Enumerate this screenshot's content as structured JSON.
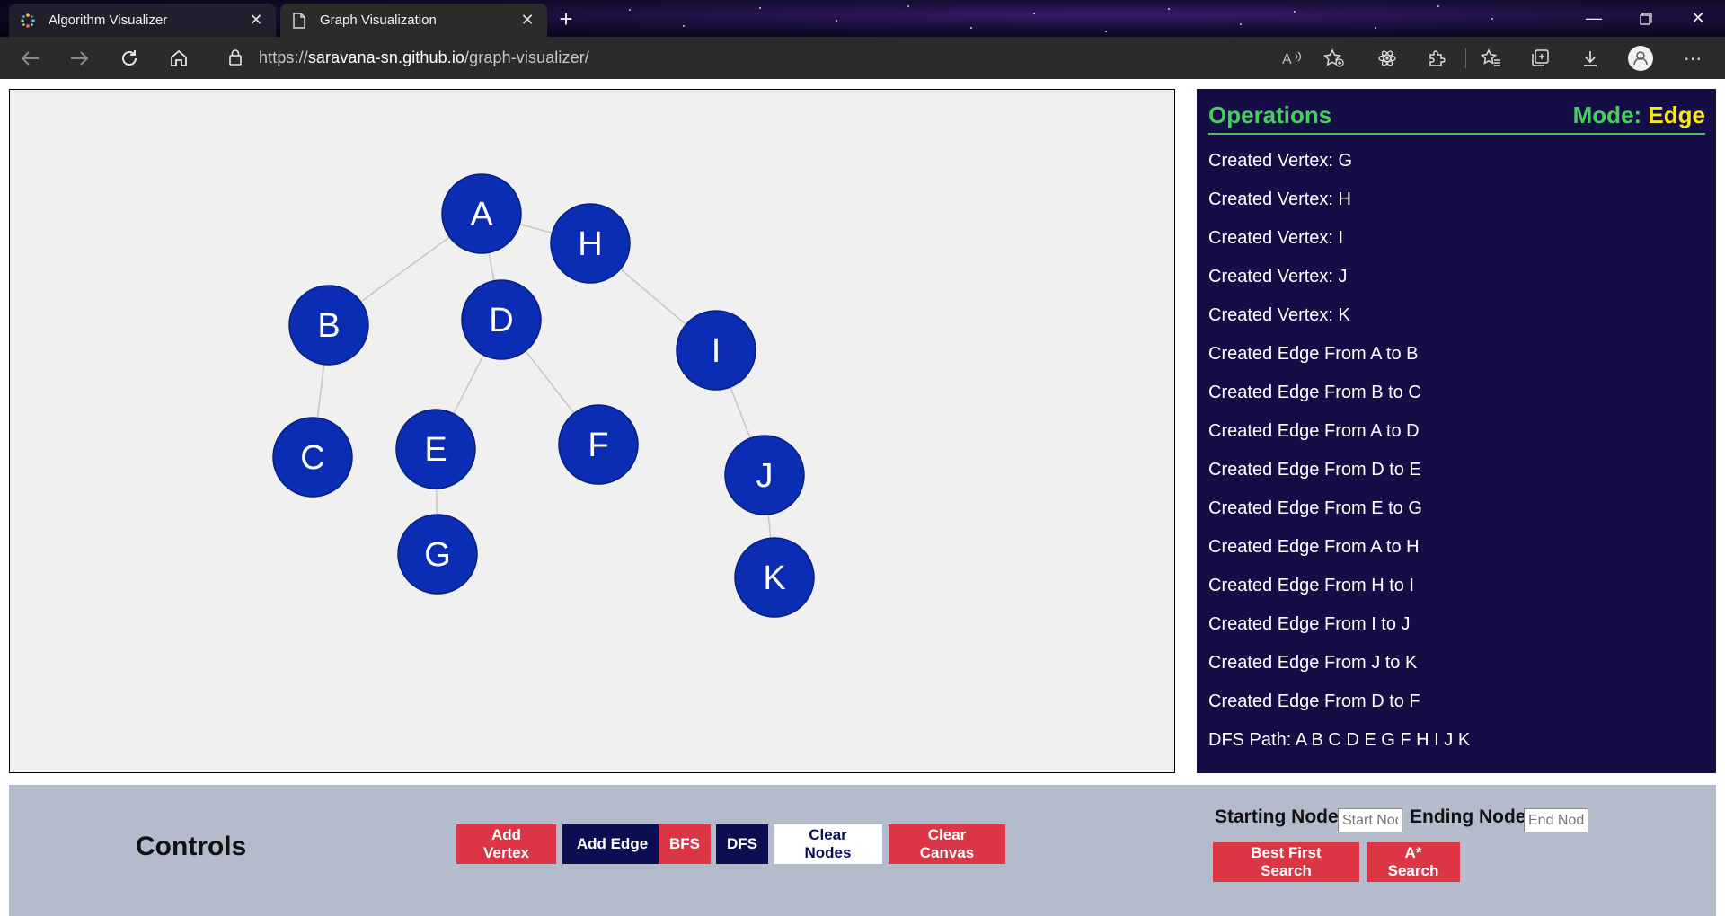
{
  "browser": {
    "tabs": [
      {
        "title": "Algorithm Visualizer",
        "active": false
      },
      {
        "title": "Graph Visualization",
        "active": true
      }
    ],
    "url_prefix": "https://",
    "url_host": "saravana-sn.github.io",
    "url_path": "/graph-visualizer/"
  },
  "graph": {
    "nodes": [
      {
        "id": "A",
        "label": "A"
      },
      {
        "id": "H",
        "label": "H"
      },
      {
        "id": "B",
        "label": "B"
      },
      {
        "id": "D",
        "label": "D"
      },
      {
        "id": "I",
        "label": "I"
      },
      {
        "id": "C",
        "label": "C"
      },
      {
        "id": "E",
        "label": "E"
      },
      {
        "id": "F",
        "label": "F"
      },
      {
        "id": "J",
        "label": "J"
      },
      {
        "id": "G",
        "label": "G"
      },
      {
        "id": "K",
        "label": "K"
      }
    ],
    "edges": [
      [
        "A",
        "B"
      ],
      [
        "B",
        "C"
      ],
      [
        "A",
        "D"
      ],
      [
        "D",
        "E"
      ],
      [
        "E",
        "G"
      ],
      [
        "A",
        "H"
      ],
      [
        "H",
        "I"
      ],
      [
        "I",
        "J"
      ],
      [
        "J",
        "K"
      ],
      [
        "D",
        "F"
      ]
    ],
    "node_color": "#0a2db4"
  },
  "operations": {
    "title": "Operations",
    "mode_label": "Mode:",
    "mode_value": "Edge",
    "log": [
      "Created Vertex: G",
      "Created Vertex: H",
      "Created Vertex: I",
      "Created Vertex: J",
      "Created Vertex: K",
      "Created Edge From A to B",
      "Created Edge From B to C",
      "Created Edge From A to D",
      "Created Edge From D to E",
      "Created Edge From E to G",
      "Created Edge From A to H",
      "Created Edge From H to I",
      "Created Edge From I to J",
      "Created Edge From J to K",
      "Created Edge From D to F",
      "DFS Path: A B C D E G F H I J K"
    ]
  },
  "controls": {
    "title": "Controls",
    "add_vertex": "Add Vertex",
    "add_edge": "Add Edge",
    "bfs": "BFS",
    "dfs": "DFS",
    "clear_nodes": "Clear Nodes",
    "clear_canvas": "Clear Canvas",
    "starting_node_label": "Starting Node",
    "starting_node_placeholder": "Start Node",
    "ending_node_label": "Ending Node",
    "ending_node_placeholder": "End Node",
    "best_first": "Best First Search",
    "astar": "A* Search"
  }
}
